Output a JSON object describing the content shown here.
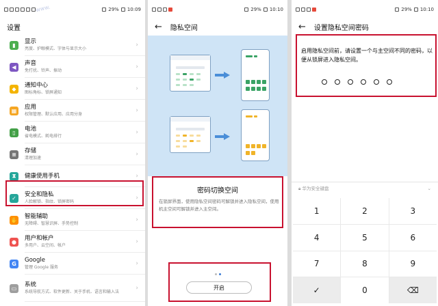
{
  "status": {
    "battery": "29%",
    "panels": [
      {
        "time": "10:09"
      },
      {
        "time": "10:10"
      },
      {
        "time": "10:10"
      }
    ]
  },
  "settings": {
    "title": "设置",
    "items": [
      {
        "title": "显示",
        "subtitle": "亮度、护眼模式、字体与显示大小",
        "color": "#4caf50",
        "icon": "display-icon"
      },
      {
        "title": "声音",
        "subtitle": "免打扰、铃声、振动",
        "color": "#7e57c2",
        "icon": "sound-icon"
      },
      {
        "title": "通知中心",
        "subtitle": "图标角标、锁屏通知",
        "color": "#f4b400",
        "icon": "bell-icon"
      },
      {
        "title": "应用",
        "subtitle": "权限管理、默认应用、应用分身",
        "color": "#f5a623",
        "icon": "apps-icon"
      },
      {
        "title": "电池",
        "subtitle": "省电模式、耗电排行",
        "color": "#43a047",
        "icon": "battery-icon"
      },
      {
        "title": "存储",
        "subtitle": "清理加速",
        "color": "#757575",
        "icon": "storage-icon"
      },
      {
        "title": "健康使用手机",
        "subtitle": "",
        "color": "#26a69a",
        "icon": "hourglass-icon"
      },
      {
        "title": "安全和隐私",
        "subtitle": "人脸解锁、指纹、锁屏密码",
        "color": "#26a69a",
        "icon": "shield-icon"
      },
      {
        "title": "智能辅助",
        "subtitle": "无障碍、智慧识屏、手势控制",
        "color": "#ff8f00",
        "icon": "hand-icon"
      },
      {
        "title": "用户和帐户",
        "subtitle": "多用户、云空间、帐户",
        "color": "#ef5350",
        "icon": "user-icon"
      },
      {
        "title": "Google",
        "subtitle": "管理 Google 服务",
        "color": "#4285f4",
        "icon": "google-icon"
      },
      {
        "title": "系统",
        "subtitle": "系统导航方式、软件更新、关于手机、语言和输入法",
        "color": "#9e9e9e",
        "icon": "system-icon"
      }
    ]
  },
  "privacy": {
    "title": "隐私空间",
    "heading": "密码切换空间",
    "description": "在锁屏界面，使用隐私空间密码可解锁并进入隐私空间，使用机主空间可解锁并进入主空间。",
    "button": "开启"
  },
  "password": {
    "title": "设置隐私空间密码",
    "description": "启用隐私空间前，请设置一个与主空间不同的密码，以便从锁屏进入隐私空间。",
    "keyboard_label": "华为安全键盘",
    "keys": [
      "1",
      "2",
      "3",
      "4",
      "5",
      "6",
      "7",
      "8",
      "9",
      "✓",
      "0",
      "⌫"
    ]
  },
  "colors": {
    "highlight": "#c8102e",
    "illustration_bg": "#cfe4f6",
    "arrow": "#4a8ed8"
  }
}
